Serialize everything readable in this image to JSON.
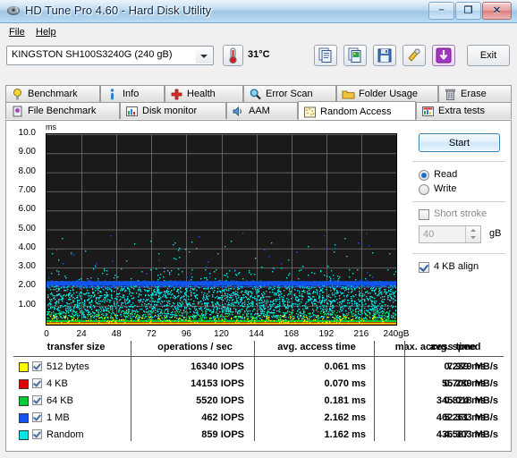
{
  "window": {
    "title": "HD Tune Pro 4.60 - Hard Disk Utility",
    "app_icon": "harddisk-icon",
    "minimize": "–",
    "maximize": "❐",
    "close": "✕"
  },
  "menu": [
    {
      "label": "File",
      "accel": "F"
    },
    {
      "label": "Help",
      "accel": "H"
    }
  ],
  "toolbar": {
    "disk_selected": "KINGSTON SH100S3240G (240 gB)",
    "temperature": "31°C",
    "exit_label": "Exit",
    "buttons": [
      {
        "name": "copy-icon"
      },
      {
        "name": "copy-image-icon"
      },
      {
        "name": "save-icon"
      },
      {
        "name": "tools-icon"
      },
      {
        "name": "download-icon"
      }
    ]
  },
  "tabs_row1": [
    {
      "label": "Benchmark",
      "icon": "bulb-icon",
      "active": false
    },
    {
      "label": "Info",
      "icon": "info-icon",
      "active": false
    },
    {
      "label": "Health",
      "icon": "health-cross-icon",
      "active": false
    },
    {
      "label": "Error Scan",
      "icon": "magnifier-icon",
      "active": false
    },
    {
      "label": "Folder Usage",
      "icon": "folder-icon",
      "active": false
    },
    {
      "label": "Erase",
      "icon": "trash-icon",
      "active": false
    }
  ],
  "tabs_row2": [
    {
      "label": "File Benchmark",
      "icon": "file-benchmark-icon",
      "active": false
    },
    {
      "label": "Disk monitor",
      "icon": "disk-monitor-icon",
      "active": false
    },
    {
      "label": "AAM",
      "icon": "speaker-icon",
      "active": false
    },
    {
      "label": "Random Access",
      "icon": "scatter-dots-icon",
      "active": true
    },
    {
      "label": "Extra tests",
      "icon": "extra-tests-icon",
      "active": false
    }
  ],
  "controls": {
    "start_label": "Start",
    "read_label": "Read",
    "write_label": "Write",
    "read_selected": true,
    "write_selected": false,
    "short_stroke_label": "Short stroke",
    "short_stroke_checked": false,
    "short_stroke_value": "40",
    "short_stroke_unit": "gB",
    "align_label": "4 KB align",
    "align_checked": true
  },
  "chart_data": {
    "type": "scatter",
    "title": "",
    "xlabel": "",
    "ylabel": "ms",
    "xlim": [
      0,
      240
    ],
    "ylim": [
      0,
      10
    ],
    "xticks": [
      "0",
      "24",
      "48",
      "72",
      "96",
      "120",
      "144",
      "168",
      "192",
      "216",
      "240gB"
    ],
    "yticks": [
      "10.0",
      "9.00",
      "8.00",
      "7.00",
      "6.00",
      "5.00",
      "4.00",
      "3.00",
      "2.00",
      "1.00"
    ],
    "grid": true,
    "background": "#1a1a1a",
    "grid_color": "#6e6e6e",
    "legend_position": "below-table",
    "series": [
      {
        "name": "512 bytes",
        "color": "#ffff00",
        "avg_access_ms": 0.061,
        "max_access_ms": 0.239,
        "style": "line-bottom"
      },
      {
        "name": "4 KB",
        "color": "#dd0000",
        "avg_access_ms": 0.07,
        "max_access_ms": 0.7,
        "style": "line-bottom"
      },
      {
        "name": "64 KB",
        "color": "#00cc33",
        "avg_access_ms": 0.181,
        "max_access_ms": 0.824,
        "style": "line"
      },
      {
        "name": "1 MB",
        "color": "#1155ee",
        "avg_access_ms": 2.162,
        "max_access_ms": 5.261,
        "style": "band"
      },
      {
        "name": "Random",
        "color": "#00e5e5",
        "avg_access_ms": 1.162,
        "max_access_ms": 4.587,
        "style": "scatter"
      }
    ]
  },
  "table": {
    "columns": [
      "transfer size",
      "operations / sec",
      "avg. access time",
      "max. access time",
      "avg. speed"
    ],
    "rows": [
      {
        "color": "#ffff00",
        "checked": true,
        "transfer_size": "512 bytes",
        "ops": "16340 IOPS",
        "avg_access": "0.061 ms",
        "max_access": "0.239 ms",
        "avg_speed": "7.979 MB/s"
      },
      {
        "color": "#dd0000",
        "checked": true,
        "transfer_size": "4 KB",
        "ops": "14153 IOPS",
        "avg_access": "0.070 ms",
        "max_access": "0.700 ms",
        "avg_speed": "55.289 MB/s"
      },
      {
        "color": "#00cc33",
        "checked": true,
        "transfer_size": "64 KB",
        "ops": "5520 IOPS",
        "avg_access": "0.181 ms",
        "max_access": "0.824 ms",
        "avg_speed": "345.018 MB/s"
      },
      {
        "color": "#1155ee",
        "checked": true,
        "transfer_size": "1 MB",
        "ops": "462 IOPS",
        "avg_access": "2.162 ms",
        "max_access": "5.261 ms",
        "avg_speed": "462.333 MB/s"
      },
      {
        "color": "#00e5e5",
        "checked": true,
        "transfer_size": "Random",
        "ops": "859 IOPS",
        "avg_access": "1.162 ms",
        "max_access": "4.587 ms",
        "avg_speed": "436.303 MB/s"
      }
    ]
  }
}
